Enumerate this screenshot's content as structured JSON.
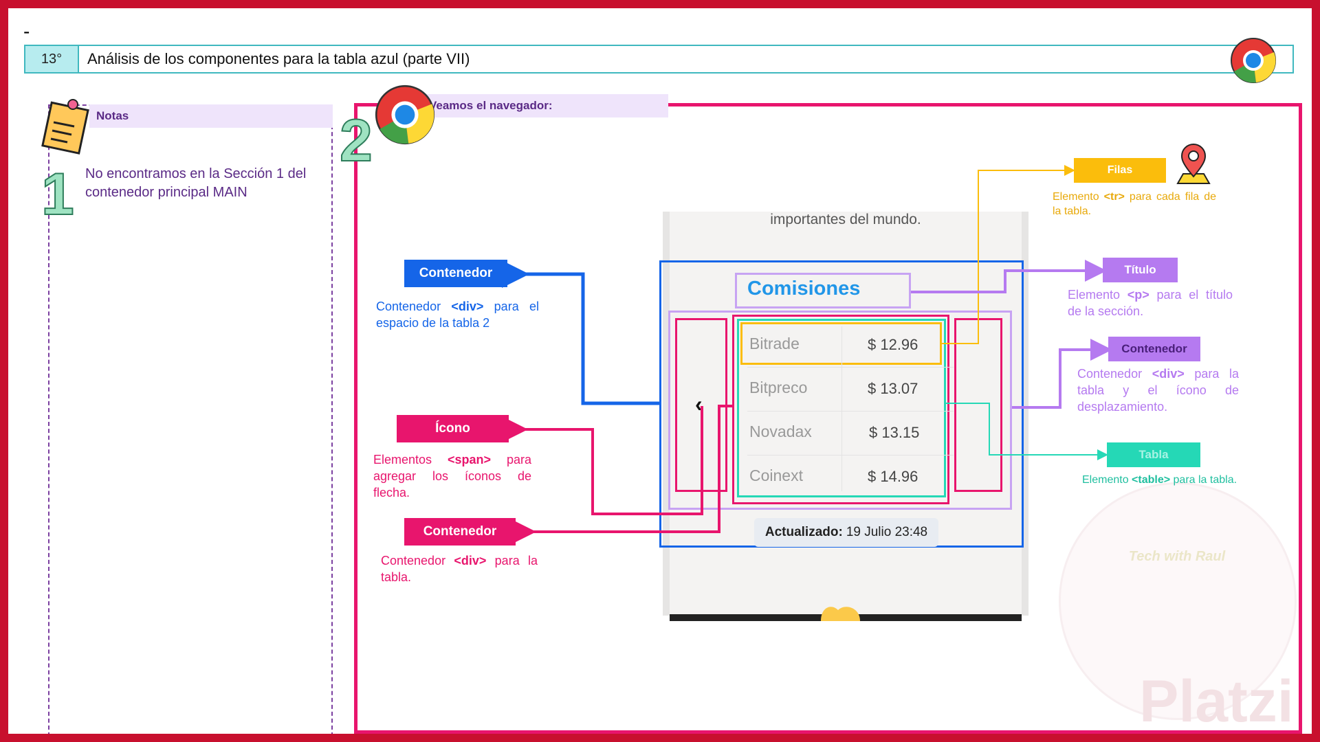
{
  "header": {
    "dash": "-",
    "number": "13°",
    "title": "Análisis de los componentes para la tabla azul (parte VII)"
  },
  "notes": {
    "label": "Notas",
    "step": "1",
    "text": "No encontramos en la Sección 1 del contenedor principal MAIN"
  },
  "browser": {
    "label": "Veamos el navegador:",
    "step": "2"
  },
  "screenshot": {
    "intro_text": "importantes del mundo.",
    "title": "Comisiones",
    "rows": [
      {
        "name": "Bitrade",
        "price": "$ 12.96"
      },
      {
        "name": "Bitpreco",
        "price": "$ 13.07"
      },
      {
        "name": "Novadax",
        "price": "$ 13.15"
      },
      {
        "name": "Coinext",
        "price": "$ 14.96"
      }
    ],
    "arrow_glyph": "‹",
    "updated_label": "Actualizado:",
    "updated_value": "19 Julio 23:48"
  },
  "annotations": {
    "contenedor_left": {
      "label": "Contenedor",
      "pre": "Contenedor ",
      "tag": "<div>",
      "post": " para el espacio de la tabla 2",
      "color": "#1565e8"
    },
    "icono": {
      "label": "Ícono",
      "pre": "Elementos ",
      "tag": "<span>",
      "post": " para agregar los íconos de flecha.",
      "color": "#e8156d"
    },
    "contenedor_tabla": {
      "label": "Contenedor",
      "pre": "Contenedor ",
      "tag": "<div>",
      "post": " para la tabla.",
      "color": "#e8156d"
    },
    "filas": {
      "label": "Filas",
      "pre": "Elemento ",
      "tag": "<tr>",
      "post": " para cada fila de la tabla.",
      "color": "#fbbd0c"
    },
    "titulo": {
      "label": "Título",
      "pre": "Elemento ",
      "tag": "<p>",
      "post": " para el título de la sección.",
      "color": "#b57af0"
    },
    "contenedor_right": {
      "label": "Contenedor",
      "pre": "Contenedor ",
      "tag": "<div>",
      "post": " para la tabla y el ícono de desplazamiento.",
      "color": "#a26be6"
    },
    "tabla": {
      "label": "Tabla",
      "pre": "Elemento ",
      "tag": "<table>",
      "post": " para la tabla.",
      "color": "#25d8b6"
    }
  },
  "watermark": {
    "brand": "Platzi",
    "tech": "Tech with Raul"
  }
}
